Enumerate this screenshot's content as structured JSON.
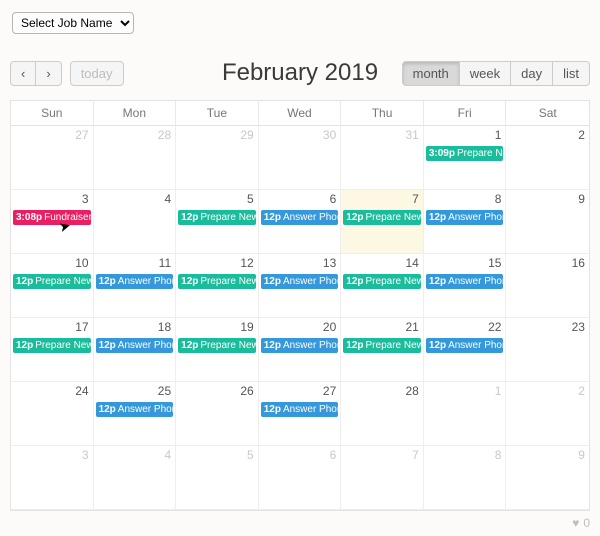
{
  "jobSelect": {
    "placeholder": "Select Job Name"
  },
  "nav": {
    "prev": "‹",
    "next": "›",
    "today": "today"
  },
  "title": "February 2019",
  "views": {
    "month": "month",
    "week": "week",
    "day": "day",
    "list": "list",
    "active": "month"
  },
  "dow": [
    "Sun",
    "Mon",
    "Tue",
    "Wed",
    "Thu",
    "Fri",
    "Sat"
  ],
  "colors": {
    "green": "#1abc9c",
    "blue": "#3498db",
    "pink": "#e91e63"
  },
  "eventLabels": {
    "prepare": "Prepare Newsl",
    "prepareShort": "Prepare New",
    "answer": "Answer Phone",
    "fund": "Fundraiser P"
  },
  "weeks": [
    [
      {
        "n": 27,
        "other": true
      },
      {
        "n": 28,
        "other": true
      },
      {
        "n": 29,
        "other": true
      },
      {
        "n": 30,
        "other": true
      },
      {
        "n": 31,
        "other": true
      },
      {
        "n": 1,
        "events": [
          {
            "t": "3:09p",
            "k": "prepareShort",
            "c": "green"
          }
        ]
      },
      {
        "n": 2
      }
    ],
    [
      {
        "n": 3,
        "events": [
          {
            "t": "3:08p",
            "k": "fund",
            "c": "pink"
          }
        ]
      },
      {
        "n": 4
      },
      {
        "n": 5,
        "events": [
          {
            "t": "12p",
            "k": "prepare",
            "c": "green"
          }
        ]
      },
      {
        "n": 6,
        "events": [
          {
            "t": "12p",
            "k": "answer",
            "c": "blue"
          }
        ]
      },
      {
        "n": 7,
        "today": true,
        "events": [
          {
            "t": "12p",
            "k": "prepare",
            "c": "green"
          }
        ]
      },
      {
        "n": 8,
        "events": [
          {
            "t": "12p",
            "k": "answer",
            "c": "blue"
          }
        ]
      },
      {
        "n": 9
      }
    ],
    [
      {
        "n": 10,
        "events": [
          {
            "t": "12p",
            "k": "prepare",
            "c": "green"
          }
        ]
      },
      {
        "n": 11,
        "events": [
          {
            "t": "12p",
            "k": "answer",
            "c": "blue"
          }
        ]
      },
      {
        "n": 12,
        "events": [
          {
            "t": "12p",
            "k": "prepare",
            "c": "green"
          }
        ]
      },
      {
        "n": 13,
        "events": [
          {
            "t": "12p",
            "k": "answer",
            "c": "blue"
          }
        ]
      },
      {
        "n": 14,
        "events": [
          {
            "t": "12p",
            "k": "prepare",
            "c": "green"
          }
        ]
      },
      {
        "n": 15,
        "events": [
          {
            "t": "12p",
            "k": "answer",
            "c": "blue"
          }
        ]
      },
      {
        "n": 16
      }
    ],
    [
      {
        "n": 17,
        "events": [
          {
            "t": "12p",
            "k": "prepare",
            "c": "green"
          }
        ]
      },
      {
        "n": 18,
        "events": [
          {
            "t": "12p",
            "k": "answer",
            "c": "blue"
          }
        ]
      },
      {
        "n": 19,
        "events": [
          {
            "t": "12p",
            "k": "prepare",
            "c": "green"
          }
        ]
      },
      {
        "n": 20,
        "events": [
          {
            "t": "12p",
            "k": "answer",
            "c": "blue"
          }
        ]
      },
      {
        "n": 21,
        "events": [
          {
            "t": "12p",
            "k": "prepare",
            "c": "green"
          }
        ]
      },
      {
        "n": 22,
        "events": [
          {
            "t": "12p",
            "k": "answer",
            "c": "blue"
          }
        ]
      },
      {
        "n": 23
      }
    ],
    [
      {
        "n": 24
      },
      {
        "n": 25,
        "events": [
          {
            "t": "12p",
            "k": "answer",
            "c": "blue"
          }
        ]
      },
      {
        "n": 26
      },
      {
        "n": 27,
        "events": [
          {
            "t": "12p",
            "k": "answer",
            "c": "blue"
          }
        ]
      },
      {
        "n": 28
      },
      {
        "n": 1,
        "other": true
      },
      {
        "n": 2,
        "other": true
      }
    ],
    [
      {
        "n": 3,
        "other": true
      },
      {
        "n": 4,
        "other": true
      },
      {
        "n": 5,
        "other": true
      },
      {
        "n": 6,
        "other": true
      },
      {
        "n": 7,
        "other": true
      },
      {
        "n": 8,
        "other": true
      },
      {
        "n": 9,
        "other": true
      }
    ]
  ],
  "footer": {
    "count": "0"
  }
}
